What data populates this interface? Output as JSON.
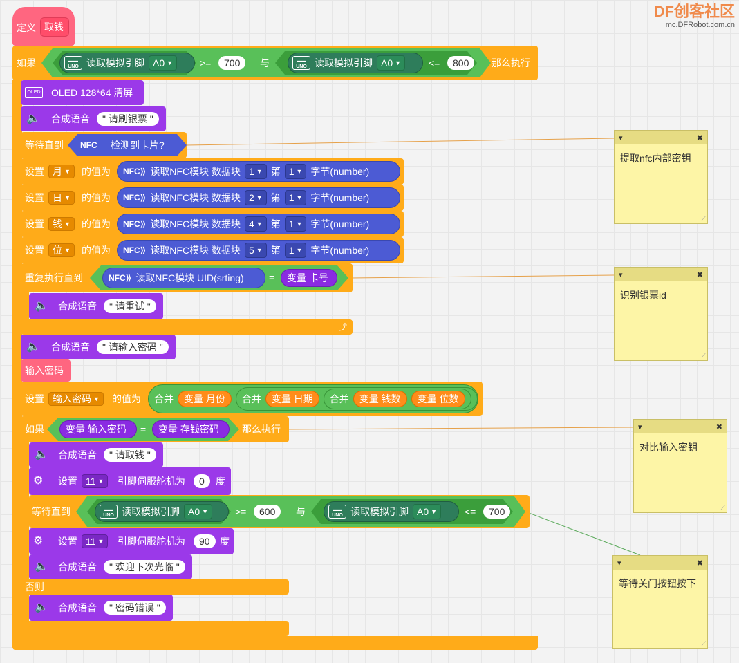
{
  "logo": {
    "title": "DF创客社区",
    "url": "mc.DFRobot.com.cn"
  },
  "define": {
    "label": "定义",
    "name": "取钱"
  },
  "if1": {
    "if_label": "如果",
    "read_label": "读取模拟引脚",
    "pin": "A0",
    "op1": ">=",
    "val1": "700",
    "and": "与",
    "op2": "<=",
    "val2": "800",
    "then": "那么执行"
  },
  "oled": {
    "label": "OLED 128*64 清屏",
    "icon": "OLED"
  },
  "speak_label": "合成语音",
  "say1": "\" 请刷银票 \"",
  "wait1": {
    "label": "等待直到",
    "nfc": "NFC",
    "text": "检测到卡片?"
  },
  "set_label": "设置",
  "value_label": "的值为",
  "nfc_read": {
    "label": "读取NFC模块 数据块",
    "nth": "第",
    "unit": "字节(number)"
  },
  "sets": [
    {
      "var": "月",
      "block": "1",
      "byte": "1"
    },
    {
      "var": "日",
      "block": "2",
      "byte": "1"
    },
    {
      "var": "钱",
      "block": "4",
      "byte": "1"
    },
    {
      "var": "位",
      "block": "5",
      "byte": "1"
    }
  ],
  "repeat": {
    "label": "重复执行直到",
    "uid": "读取NFC模块 UID(srting)",
    "eq": "=",
    "var": "变量 卡号"
  },
  "say2": "\" 请重试 \"",
  "say3": "\" 请输入密码 \"",
  "input_pwd": "输入密码",
  "set_pwd": {
    "var": "输入密码",
    "merge": "合并",
    "v1": "变量 月份",
    "v2": "变量 日期",
    "v3": "变量 钱数",
    "v4": "变量 位数"
  },
  "if2": {
    "if_label": "如果",
    "a": "变量 输入密码",
    "eq": "=",
    "b": "变量 存钱密码",
    "then": "那么执行"
  },
  "say4": "\" 请取钱 \"",
  "servo": {
    "set": "设置",
    "pin": "11",
    "label": "引脚伺服舵机为",
    "deg": "度",
    "v1": "0",
    "v2": "90"
  },
  "wait2": {
    "label": "等待直到",
    "val1": "600",
    "val2": "700",
    "op1": ">=",
    "op2": "<="
  },
  "say5": "\" 欢迎下次光临 \"",
  "else": "否则",
  "say6": "\" 密码错误 \"",
  "notes": [
    {
      "text": "提取nfc内部密钥"
    },
    {
      "text": "识别银票id"
    },
    {
      "text": "对比输入密钥"
    },
    {
      "text": "等待关门按钮按下"
    }
  ],
  "colors": {
    "control": "#ffab19",
    "sound": "#9b39e9",
    "define": "#ff6680",
    "logic": "#59c059",
    "nfc": "#4c5bd4"
  }
}
